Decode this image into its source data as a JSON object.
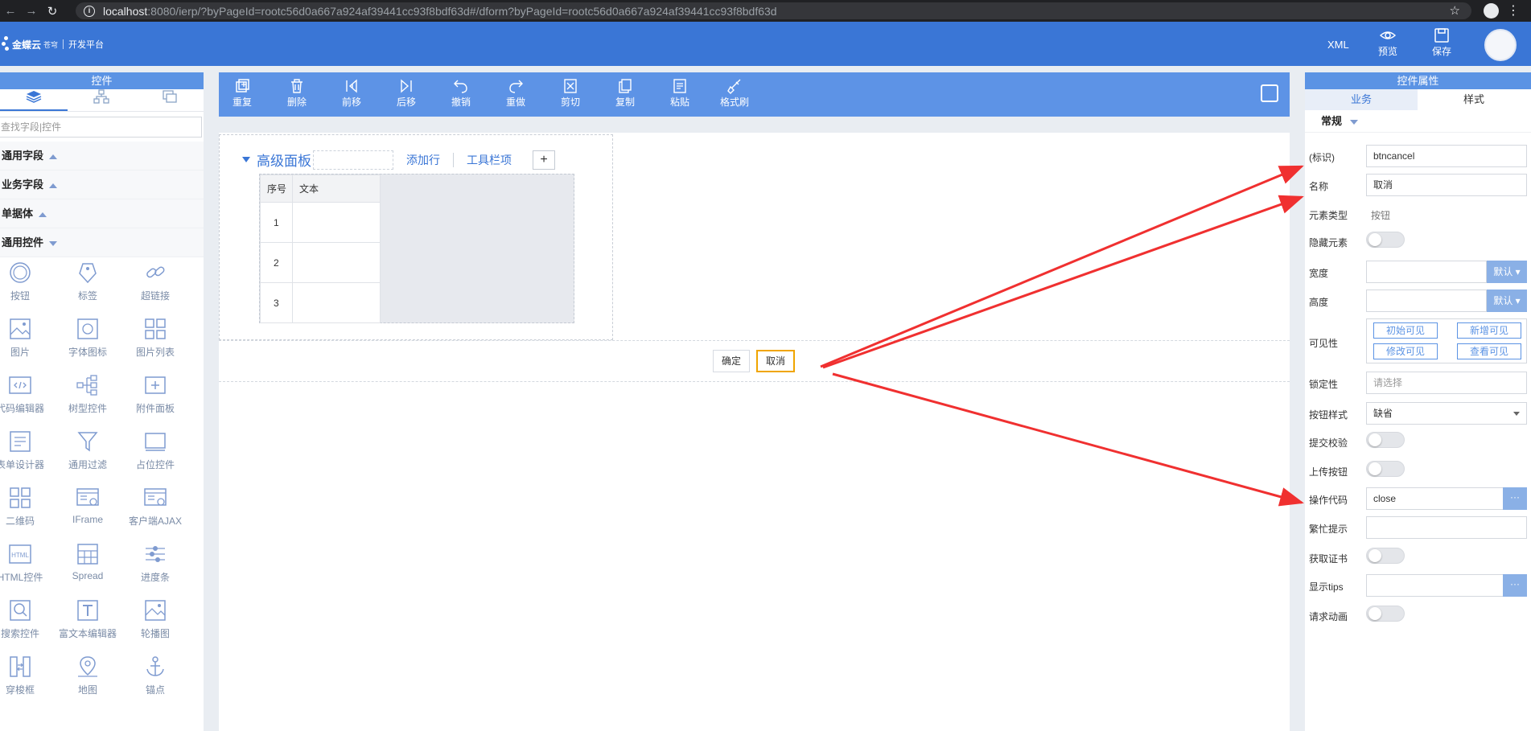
{
  "browser": {
    "url_host": "localhost",
    "url_path": ":8080/ierp/?byPageId=rootc56d0a667a924af39441cc93f8bdf63d#/dform?byPageId=rootc56d0a667a924af39441cc93f8bdf63d",
    "back_icon": "arrow-left-icon",
    "forward_icon": "arrow-right-icon",
    "reload_icon": "reload-icon"
  },
  "header": {
    "logo_text": "金蝶云",
    "logo_sub": "苍穹",
    "platform": "开发平台",
    "xml_label": "XML",
    "preview_label": "预览",
    "save_label": "保存"
  },
  "left_panel": {
    "title": "控件",
    "search_placeholder": "查找字段|控件",
    "groups": [
      {
        "label": "通用字段",
        "expanded": false
      },
      {
        "label": "业务字段",
        "expanded": false
      },
      {
        "label": "单据体",
        "expanded": false
      },
      {
        "label": "通用控件",
        "expanded": true
      }
    ],
    "controls": [
      {
        "label": "按钮",
        "icon": "circle-button-icon"
      },
      {
        "label": "标签",
        "icon": "tag-icon"
      },
      {
        "label": "超链接",
        "icon": "link-icon"
      },
      {
        "label": "图片",
        "icon": "image-icon"
      },
      {
        "label": "字体图标",
        "icon": "font-icon"
      },
      {
        "label": "图片列表",
        "icon": "grid-icon"
      },
      {
        "label": "代码编辑器",
        "icon": "code-icon"
      },
      {
        "label": "树型控件",
        "icon": "tree-icon"
      },
      {
        "label": "附件面板",
        "icon": "plus-square-icon"
      },
      {
        "label": "表单设计器",
        "icon": "form-icon"
      },
      {
        "label": "通用过滤",
        "icon": "filter-icon"
      },
      {
        "label": "占位控件",
        "icon": "placeholder-icon"
      },
      {
        "label": "二维码",
        "icon": "qrcode-icon"
      },
      {
        "label": "IFrame",
        "icon": "iframe-icon"
      },
      {
        "label": "客户端AJAX",
        "icon": "ajax-icon"
      },
      {
        "label": "HTML控件",
        "icon": "html-icon"
      },
      {
        "label": "Spread",
        "icon": "spread-icon"
      },
      {
        "label": "进度条",
        "icon": "progress-icon"
      },
      {
        "label": "搜索控件",
        "icon": "search-icon"
      },
      {
        "label": "富文本编辑器",
        "icon": "text-icon"
      },
      {
        "label": "轮播图",
        "icon": "carousel-icon"
      },
      {
        "label": "穿梭框",
        "icon": "transfer-icon"
      },
      {
        "label": "地图",
        "icon": "map-icon"
      },
      {
        "label": "锚点",
        "icon": "anchor-icon"
      }
    ]
  },
  "toolbar": {
    "buttons": [
      {
        "label": "重复",
        "icon": "duplicate-icon"
      },
      {
        "label": "删除",
        "icon": "trash-icon"
      },
      {
        "label": "前移",
        "icon": "move-forward-icon"
      },
      {
        "label": "后移",
        "icon": "move-back-icon"
      },
      {
        "label": "撤销",
        "icon": "undo-icon"
      },
      {
        "label": "重做",
        "icon": "redo-icon"
      },
      {
        "label": "剪切",
        "icon": "cut-icon"
      },
      {
        "label": "复制",
        "icon": "copy-icon"
      },
      {
        "label": "粘贴",
        "icon": "paste-icon"
      },
      {
        "label": "格式刷",
        "icon": "brush-icon"
      }
    ]
  },
  "canvas": {
    "adv_title": "高级面板",
    "add_row": "添加行",
    "toolbar_item": "工具栏项",
    "plus": "+",
    "table_headers": [
      "序号",
      "文本"
    ],
    "rows": [
      "1",
      "2",
      "3"
    ],
    "confirm_label": "确定",
    "cancel_label": "取消"
  },
  "right_panel": {
    "title": "控件属性",
    "tabs": [
      "业务",
      "样式"
    ],
    "section": "常规",
    "key_label": "(标识)",
    "key_value": "btncancel",
    "name_label": "名称",
    "name_value": "取消",
    "type_label": "元素类型",
    "type_value": "按钮",
    "hidden_label": "隐藏元素",
    "width_label": "宽度",
    "height_label": "高度",
    "default_label": "默认",
    "visibility_label": "可见性",
    "visibility_options": [
      "初始可见",
      "新增可见",
      "修改可见",
      "查看可见"
    ],
    "lock_label": "锁定性",
    "lock_placeholder": "请选择",
    "btn_style_label": "按钮样式",
    "btn_style_value": "缺省",
    "submit_check_label": "提交校验",
    "upload_label": "上传按钮",
    "op_code_label": "操作代码",
    "op_code_value": "close",
    "busy_tip_label": "繁忙提示",
    "cert_label": "获取证书",
    "tips_label": "显示tips",
    "anim_label": "请求动画",
    "ellipsis": "···"
  },
  "annotation_color": "#f03030"
}
